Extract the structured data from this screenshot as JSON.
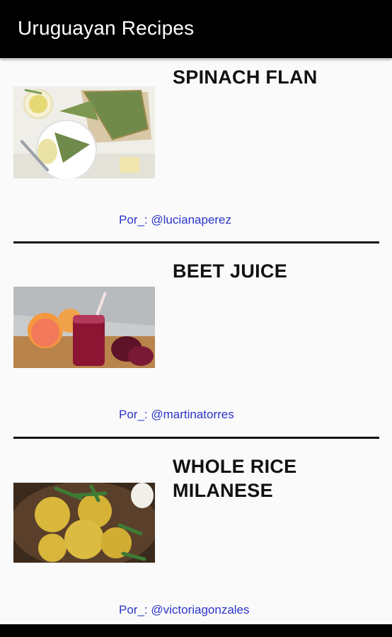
{
  "app": {
    "title": "Uruguayan Recipes"
  },
  "recipes": [
    {
      "title": "SPINACH FLAN",
      "author": "Por_: @lucianaperez",
      "image": "spinach-flan-photo"
    },
    {
      "title": "BEET JUICE",
      "author": "Por_: @martinatorres",
      "image": "beet-juice-photo"
    },
    {
      "title": "WHOLE RICE MILANESE",
      "author": "Por_: @victoriagonzales",
      "image": "whole-rice-milanese-photo"
    }
  ]
}
